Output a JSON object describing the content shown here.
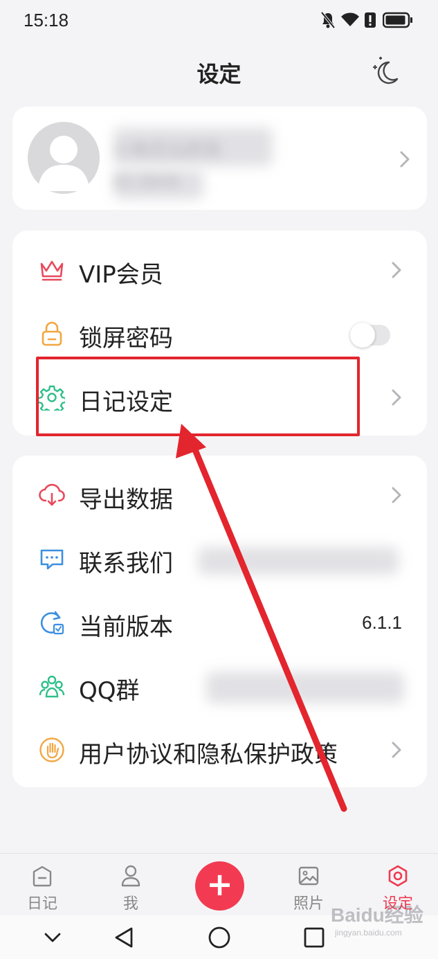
{
  "status_bar": {
    "time": "15:18",
    "icons": [
      "bell-off-icon",
      "wifi-icon",
      "alert-icon",
      "battery-icon"
    ]
  },
  "header": {
    "title": "设定",
    "night_mode_icon": "moon-stars-icon"
  },
  "profile": {
    "name": "小梅花仙颜我",
    "subtitle": "ID:3849",
    "avatar_icon": "default-avatar-icon"
  },
  "menu_group_1": [
    {
      "label": "VIP会员",
      "icon": "crown-icon",
      "color": "#e8495a",
      "control": "chevron"
    },
    {
      "label": "锁屏密码",
      "icon": "lock-icon",
      "color": "#f2a640",
      "control": "toggle",
      "toggle_on": false
    },
    {
      "label": "日记设定",
      "icon": "gear-icon",
      "color": "#2fbf8a",
      "control": "chevron"
    }
  ],
  "menu_group_2": [
    {
      "label": "导出数据",
      "icon": "cloud-download-icon",
      "color": "#e8495a",
      "control": "chevron"
    },
    {
      "label": "联系我们",
      "icon": "chat-bubble-icon",
      "color": "#3b8fe0",
      "control": "blurred"
    },
    {
      "label": "当前版本",
      "icon": "version-update-icon",
      "color": "#3b8fe0",
      "control": "value",
      "value": "6.1.1"
    },
    {
      "label": "QQ群",
      "icon": "group-people-icon",
      "color": "#2fbf8a",
      "control": "blurred"
    },
    {
      "label": "用户协议和隐私保护政策",
      "icon": "hand-stop-icon",
      "color": "#f2a640",
      "control": "chevron"
    }
  ],
  "tabbar": {
    "tabs": [
      {
        "label": "日记",
        "icon": "diary-icon",
        "active": false
      },
      {
        "label": "我",
        "icon": "person-icon",
        "active": false
      },
      {
        "label": "照片",
        "icon": "photo-icon",
        "active": false
      },
      {
        "label": "设定",
        "icon": "settings-hex-icon",
        "active": true
      }
    ],
    "fab_label": "+",
    "active_color": "#ef3950"
  },
  "system_nav": {
    "buttons": [
      "chevron-down-icon",
      "back-triangle-icon",
      "home-circle-icon",
      "recents-square-icon"
    ]
  },
  "annotation": {
    "box_color": "#e3252e"
  },
  "watermark": {
    "text": "Baidu经验",
    "sub": "jingyan.baidu.com"
  }
}
